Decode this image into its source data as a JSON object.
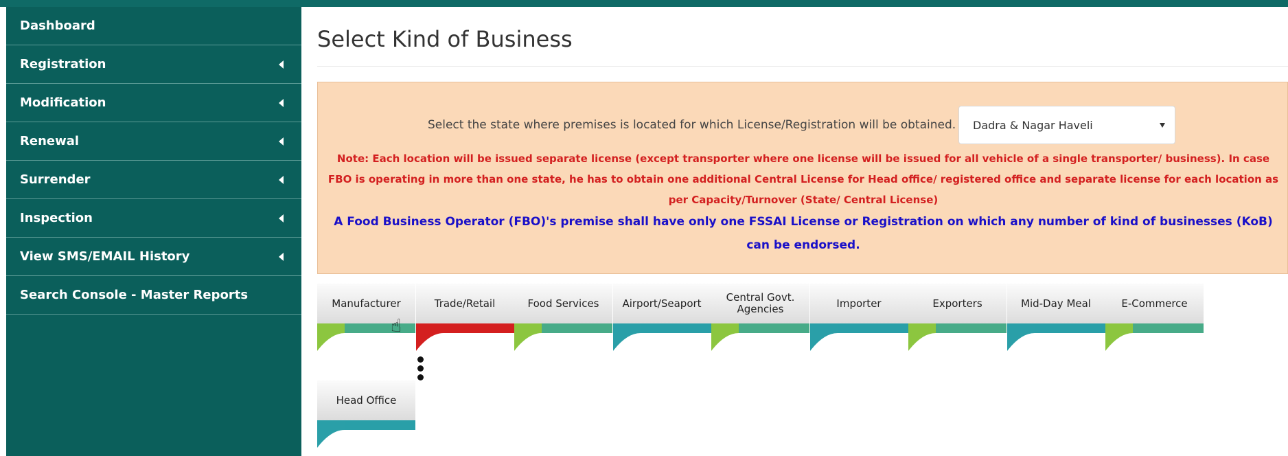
{
  "sidebar": {
    "items": [
      {
        "label": "Dashboard",
        "has_submenu": false
      },
      {
        "label": "Registration",
        "has_submenu": true
      },
      {
        "label": "Modification",
        "has_submenu": true
      },
      {
        "label": "Renewal",
        "has_submenu": true
      },
      {
        "label": "Surrender",
        "has_submenu": true
      },
      {
        "label": "Inspection",
        "has_submenu": true
      },
      {
        "label": "View SMS/EMAIL History",
        "has_submenu": true
      },
      {
        "label": "Search Console - Master Reports",
        "has_submenu": false
      }
    ]
  },
  "main": {
    "title": "Select Kind of Business",
    "state_prompt": "Select the state where premises is located for which License/Registration will be obtained.",
    "state_selected": "Dadra & Nagar Haveli",
    "note": "Note: Each location will be issued separate license (except transporter where one license will be issued for all vehicle of a single transporter/ business). In case FBO is operating in more than one state, he has to obtain one additional Central License for Head office/ registered office and separate license for each location as per Capacity/Turnover (State/ Central License)",
    "fbo_notice": "A Food Business Operator (FBO)'s premise shall have only one FSSAI License or Registration on which any number of kind of businesses (KoB) can be endorsed."
  },
  "tabs": [
    {
      "label": "Manufacturer",
      "band": "green"
    },
    {
      "label": "Trade/Retail",
      "band": "red"
    },
    {
      "label": "Food Services",
      "band": "green"
    },
    {
      "label": "Airport/Seaport",
      "band": "blue"
    },
    {
      "label": "Central Govt. Agencies",
      "band": "green"
    },
    {
      "label": "Importer",
      "band": "blue"
    },
    {
      "label": "Exporters",
      "band": "green"
    },
    {
      "label": "Mid-Day Meal",
      "band": "blue"
    },
    {
      "label": "E-Commerce",
      "band": "green"
    },
    {
      "label": "Head Office",
      "band": "blue"
    }
  ],
  "colors": {
    "sidebar": "#0b5f5b",
    "notice_bg": "#fbd9b8",
    "note_text": "#d32020",
    "fbo_text": "#1a10c8",
    "band_green": "#8cc63f",
    "band_blue": "#2a9fa8",
    "band_red": "#d41f1f"
  }
}
